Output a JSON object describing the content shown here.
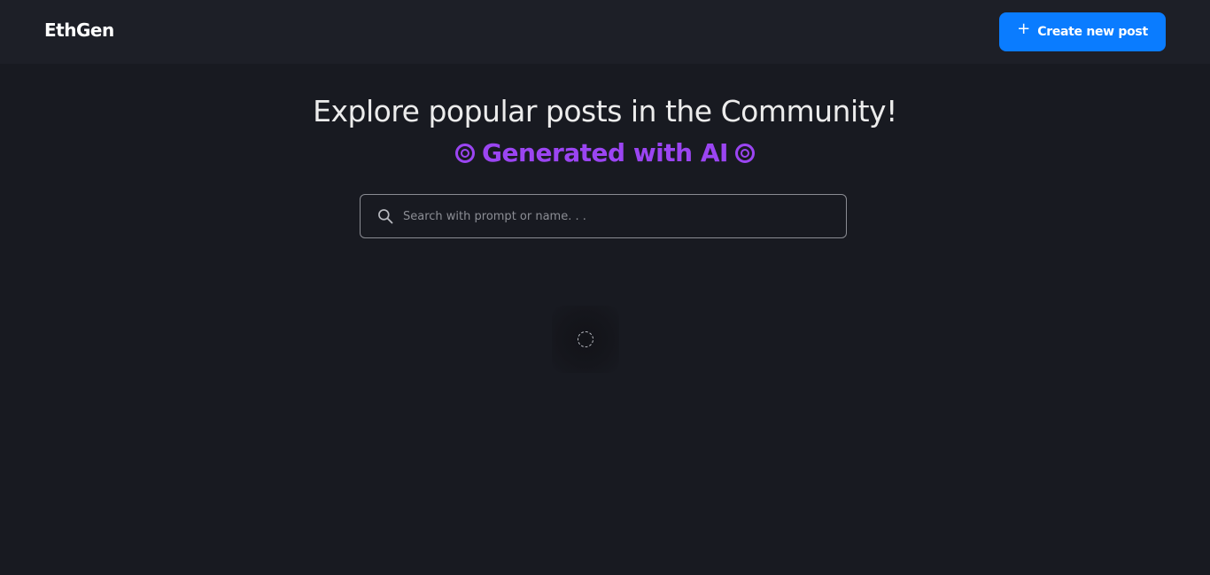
{
  "header": {
    "logo": "EthGen",
    "create_button": {
      "icon": "plus-icon",
      "label": "Create new post"
    }
  },
  "hero": {
    "title": "Explore popular posts in the Community!",
    "subtitle": "Generated with AI",
    "subtitle_icon": "target-icon"
  },
  "search": {
    "icon": "search-icon",
    "placeholder": "Search with prompt or name. . .",
    "value": ""
  },
  "loader": {
    "icon": "spinner-icon"
  },
  "colors": {
    "background": "#181a21",
    "header_background": "#1d1f27",
    "accent": "#0a7cff",
    "subtitle": "#9b45f2"
  }
}
